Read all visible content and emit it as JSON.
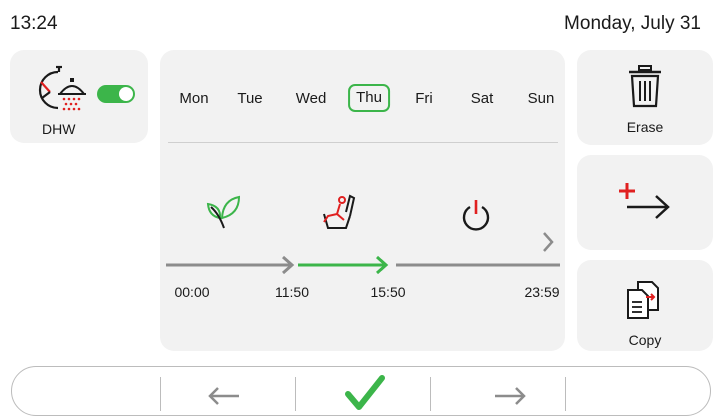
{
  "status": {
    "time": "13:24",
    "date": "Monday, July 31"
  },
  "dhw": {
    "label": "DHW",
    "toggle_on": true,
    "icon": "clock-shower-icon"
  },
  "schedule": {
    "days": [
      "Mon",
      "Tue",
      "Wed",
      "Thu",
      "Fri",
      "Sat",
      "Sun"
    ],
    "selected_day": "Thu",
    "modes": [
      "eco-leaf-icon",
      "comfort-chair-icon",
      "power-off-icon"
    ],
    "times": [
      "00:00",
      "11:50",
      "15:50",
      "23:59"
    ]
  },
  "actions": {
    "erase": "Erase",
    "copy": "Copy"
  },
  "colors": {
    "accent": "#3cb54a",
    "red": "#e02020",
    "gray": "#8c8c8c"
  }
}
